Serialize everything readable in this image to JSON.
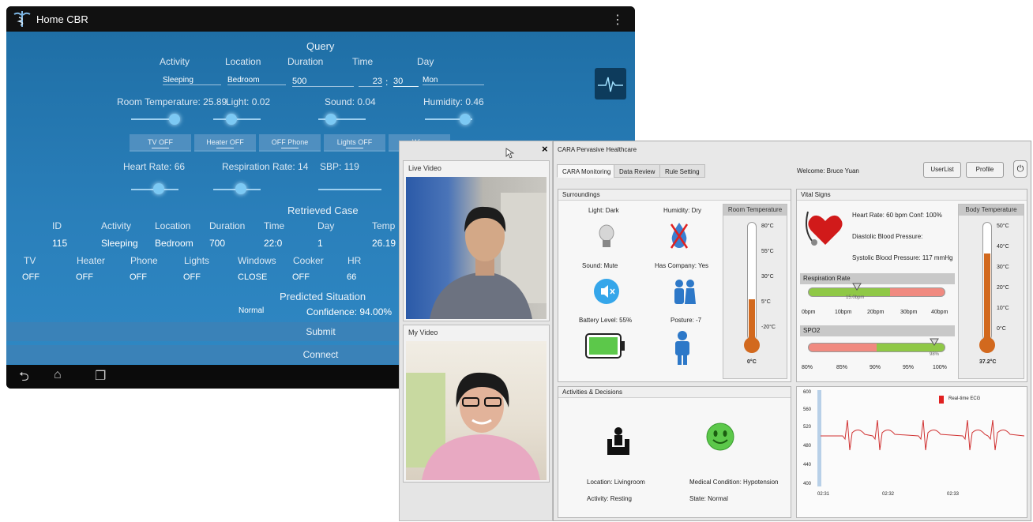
{
  "tablet": {
    "title": "Home CBR",
    "query": {
      "heading": "Query",
      "labels": {
        "activity": "Activity",
        "location": "Location",
        "duration": "Duration",
        "time": "Time",
        "day": "Day"
      },
      "values": {
        "activity": "Sleeping",
        "location": "Bedroom",
        "duration": "500",
        "hour": "23",
        "sep": ":",
        "minute": "30",
        "day": "Mon"
      }
    },
    "sensors": {
      "room_temp": "Room Temperature: 25.89",
      "light": "Light: 0.02",
      "sound": "Sound: 0.04",
      "humidity": "Humidity: 0.46"
    },
    "toggles": [
      "TV OFF",
      "Heater OFF",
      "OFF Phone",
      "Lights OFF",
      "Wi..."
    ],
    "vitals": {
      "hr": "Heart Rate: 66",
      "rr": "Respiration Rate: 14",
      "sbp": "SBP: 119"
    },
    "retrieved": {
      "heading": "Retrieved Case",
      "row1_headers": [
        "ID",
        "Activity",
        "Location",
        "Duration",
        "Time",
        "Day",
        "Temp"
      ],
      "row1_values": [
        "115",
        "Sleeping",
        "Bedroom",
        "700",
        "22:0",
        "1",
        "26.19"
      ],
      "row2_headers": [
        "TV",
        "Heater",
        "Phone",
        "Lights",
        "Windows",
        "Cooker",
        "HR"
      ],
      "row2_values": [
        "OFF",
        "OFF",
        "OFF",
        "OFF",
        "CLOSE",
        "OFF",
        "66"
      ]
    },
    "predicted": {
      "heading": "Predicted Situation",
      "situation": "Normal",
      "confidence": "Confidence: 94.00%"
    },
    "submit": "Submit",
    "connect": "Connect",
    "nav_icons": [
      "back-icon",
      "home-icon",
      "recent-apps-icon"
    ]
  },
  "videocall": {
    "close": "×",
    "live_label": "Live Video",
    "my_label": "My Video"
  },
  "cara": {
    "title": "CARA Pervasive Healthcare",
    "tabs": [
      "CARA Monitoring",
      "Data Review",
      "Rule Setting"
    ],
    "welcome": "Welcome: Bruce Yuan",
    "userlist": "UserList",
    "profile": "Profile",
    "surroundings": {
      "heading": "Surroundings",
      "light": "Light:  Dark",
      "humidity": "Humidity:  Dry",
      "sound": "Sound:  Mute",
      "company": "Has Company:  Yes",
      "battery": "Battery Level:  55%",
      "posture": "Posture:  -7",
      "room_temp_title": "Room Temperature",
      "room_ticks": [
        "80°C",
        "55°C",
        "30°C",
        "5°C",
        "-20°C"
      ],
      "room_value": "0°C"
    },
    "vitals": {
      "heading": "Vital Signs",
      "hr_line": "Heart Rate:  60 bpm   Conf:  100%",
      "dbp": "Diastolic Blood Pressure:",
      "sbp": "Systolic Blood Pressure:  117 mmHg",
      "body_temp_title": "Body Temperature",
      "body_ticks": [
        "50°C",
        "40°C",
        "30°C",
        "20°C",
        "10°C",
        "0°C"
      ],
      "body_value": "37.2°C",
      "resp_title": "Respiration Rate",
      "resp_ticks": [
        "0bpm",
        "10bpm",
        "20bpm",
        "30bpm",
        "40bpm"
      ],
      "resp_value": "15.0bpm",
      "spo2_title": "SPO2",
      "spo2_ticks": [
        "80%",
        "85%",
        "90%",
        "95%",
        "100%"
      ],
      "spo2_value": "98%"
    },
    "activities": {
      "heading": "Activities & Decisions",
      "location": "Location:  Livingroom",
      "activity": "Activity:  Resting",
      "condition": "Medical Condition:  Hypotension",
      "state": "State:  Normal"
    },
    "ecg": {
      "legend": "Real-time ECG",
      "y_ticks": [
        "600",
        "560",
        "520",
        "480",
        "440",
        "400"
      ],
      "x_ticks": [
        "02:31",
        "02:32",
        "02:33"
      ]
    }
  },
  "colors": {
    "accent": "#2a7fba",
    "red": "#e02020",
    "green": "#5cc84a"
  }
}
